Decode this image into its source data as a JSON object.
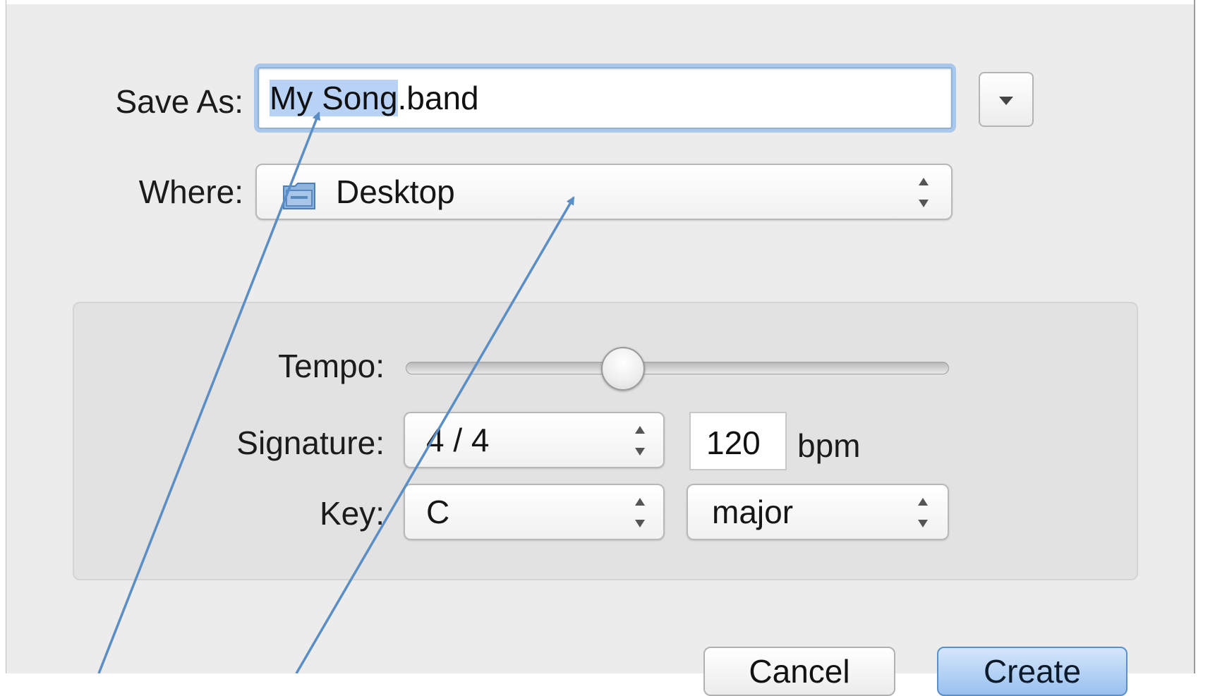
{
  "dialog": {
    "save_as": {
      "label": "Save As:",
      "value_selected": "My Song",
      "value_rest": ".band",
      "menu_button_icon": "disclosure-triangle-icon"
    },
    "where": {
      "label": "Where:",
      "value": "Desktop",
      "icon": "folder-icon"
    },
    "settings": {
      "tempo": {
        "label": "Tempo:",
        "slider_value_fraction": 0.4
      },
      "signature": {
        "label": "Signature:",
        "value": "4 / 4"
      },
      "bpm": {
        "value": "120",
        "unit": "bpm"
      },
      "key": {
        "label": "Key:",
        "value": "C",
        "mode": "major"
      }
    },
    "buttons": {
      "cancel": "Cancel",
      "create": "Create"
    }
  },
  "colors": {
    "accent": "#4f86c0",
    "selection": "#b7d2f5",
    "focus_ring": "#a9c8ec",
    "panel": "#ececec",
    "annotation_arrow": "#5b8ec4"
  }
}
